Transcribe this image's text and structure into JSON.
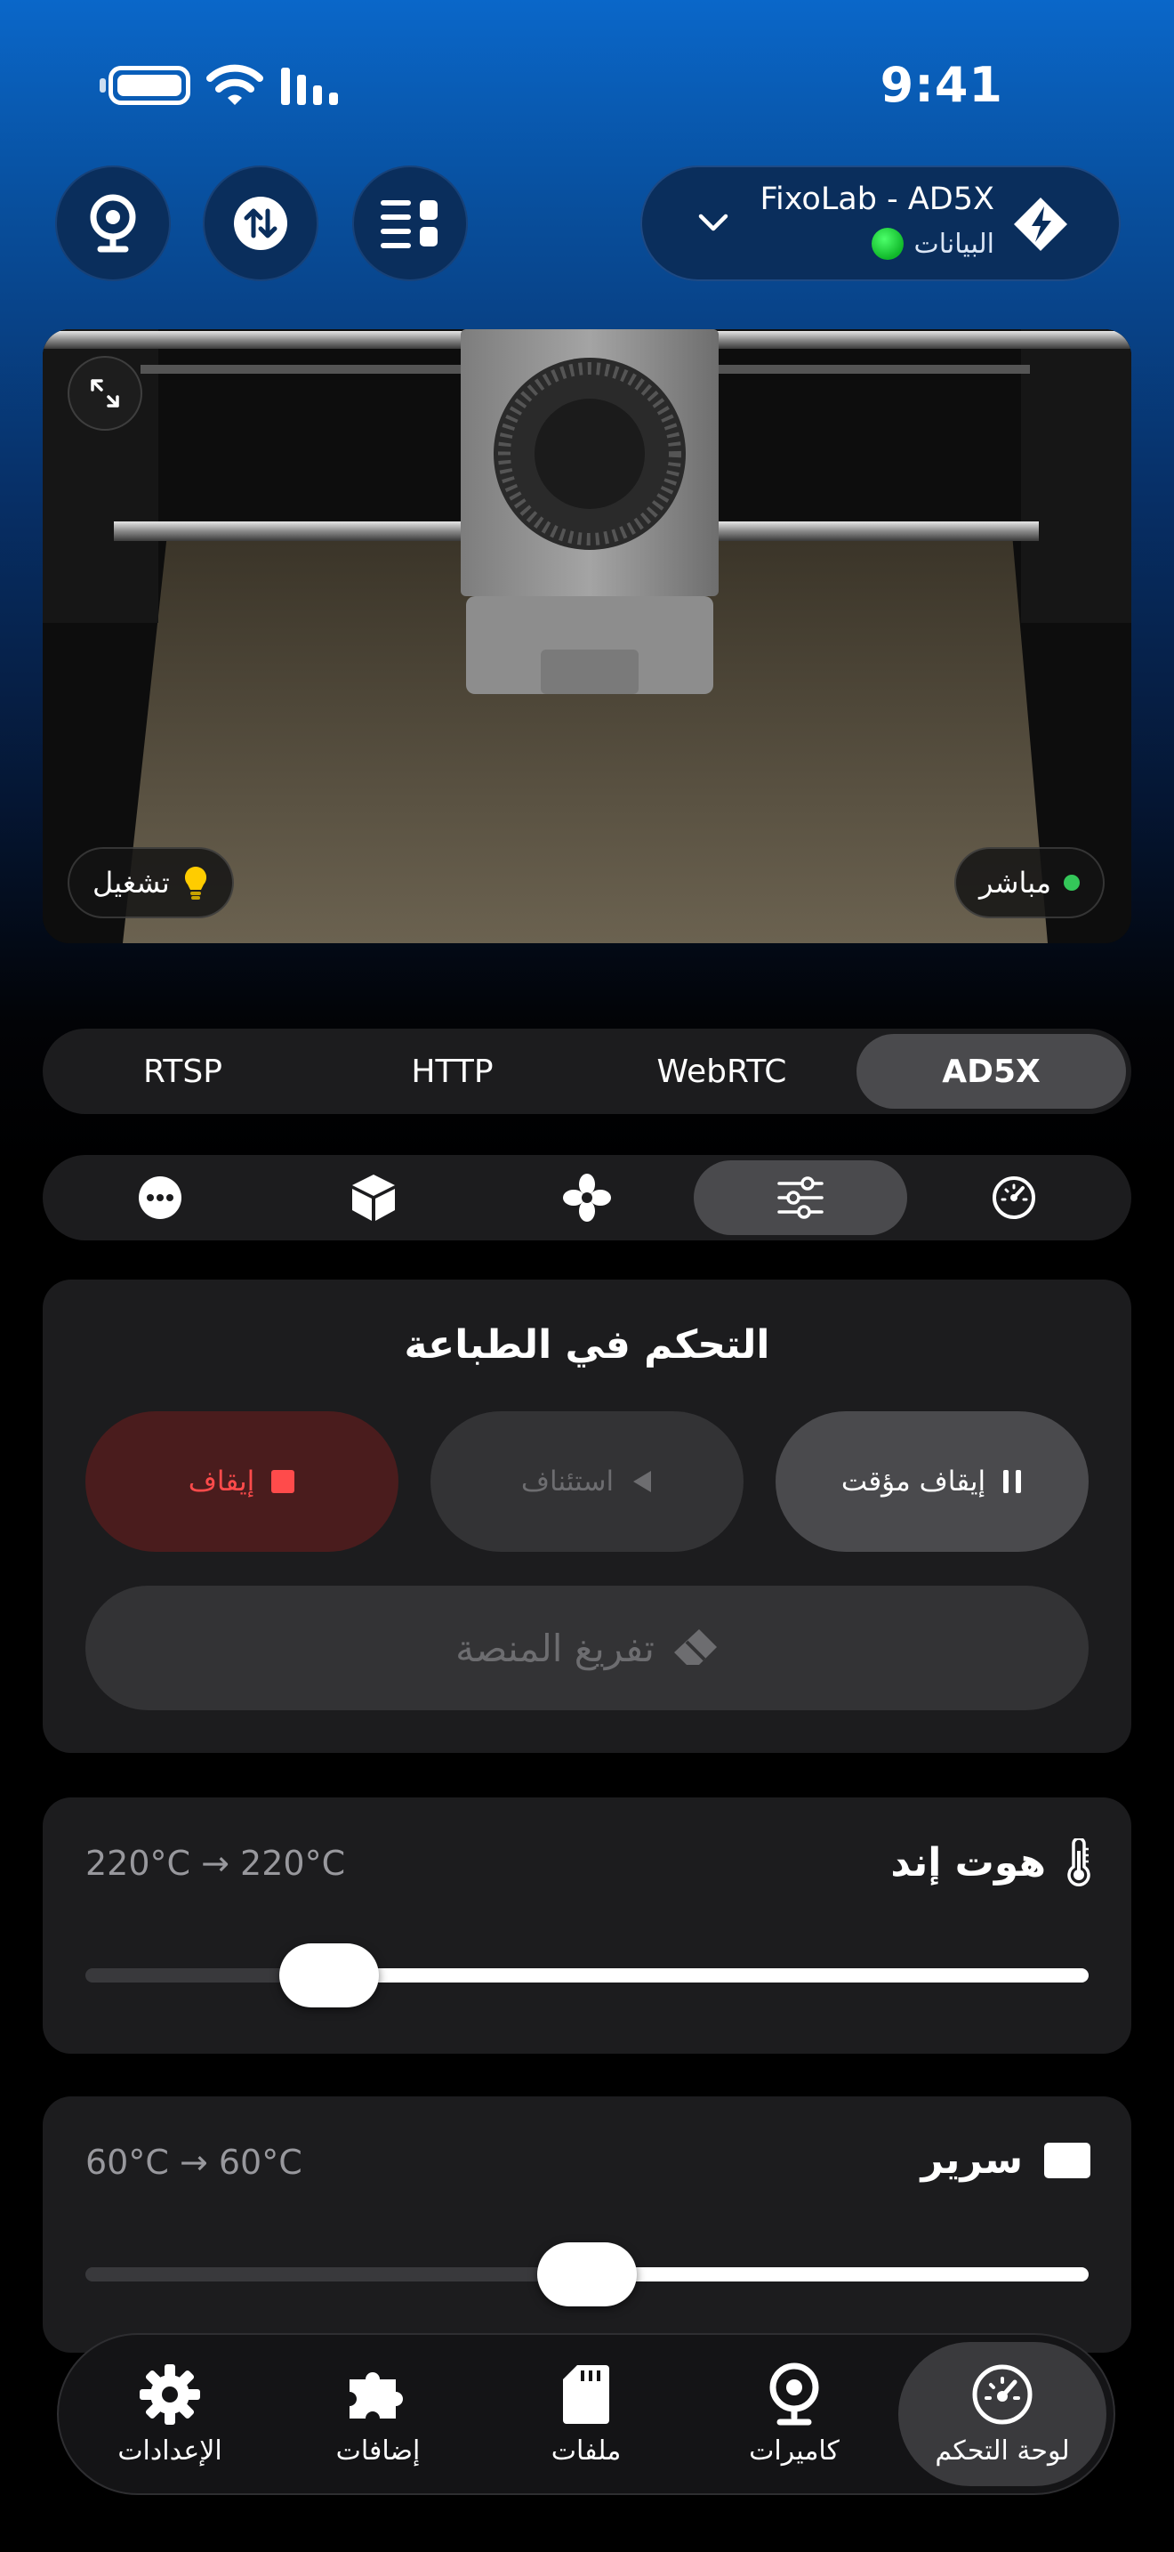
{
  "status_bar": {
    "time": "9:41"
  },
  "printer": {
    "name": "FixoLab - AD5X",
    "status_label": "البيانات",
    "status_color": "#1ed43c"
  },
  "toolbar": {
    "icons": [
      "webcam-icon",
      "transfer-icon",
      "dashboard-layout-icon"
    ]
  },
  "camera": {
    "live_label": "مباشر",
    "light_label": "تشغيل",
    "live_color": "#34c759"
  },
  "sources": {
    "items": [
      "AD5X",
      "WebRTC",
      "HTTP",
      "RTSP"
    ],
    "selected": "AD5X"
  },
  "control_tabs": {
    "icons": [
      "gauge-icon",
      "sliders-icon",
      "fan-icon",
      "box-icon",
      "more-icon"
    ],
    "selected": "sliders-icon"
  },
  "print_control": {
    "title": "التحكم في الطباعة",
    "pause_label": "إيقاف مؤقت",
    "resume_label": "استئناف",
    "stop_label": "إيقاف",
    "clear_label": "تفريغ المنصة"
  },
  "hotend": {
    "label": "هوت إند",
    "value": "220°C → 220°C",
    "level": 0.243
  },
  "bed": {
    "label": "سرير",
    "value": "60°C → 60°C",
    "level": 0.5
  },
  "bottom_nav": {
    "items": [
      {
        "label": "لوحة التحكم",
        "icon": "gauge-icon",
        "active": true
      },
      {
        "label": "كاميرات",
        "icon": "webcam-icon",
        "active": false
      },
      {
        "label": "ملفات",
        "icon": "sd-card-icon",
        "active": false
      },
      {
        "label": "إضافات",
        "icon": "puzzle-icon",
        "active": false
      },
      {
        "label": "الإعدادات",
        "icon": "gear-icon",
        "active": false
      }
    ]
  },
  "colors": {
    "accent": "#0a67c9",
    "card": "#1c1c1e",
    "stop": "#ff4b4b"
  }
}
